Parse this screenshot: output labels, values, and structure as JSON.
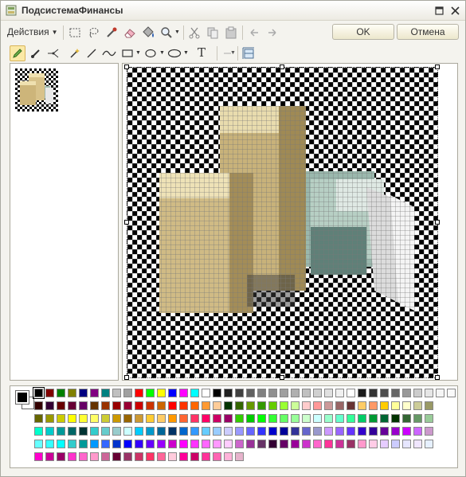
{
  "window": {
    "title": "ПодсистемаФинансы",
    "icons": [
      "app-icon",
      "maximize-icon",
      "close-icon"
    ]
  },
  "toolbar": {
    "actions_label": "Действия",
    "ok_label": "OK",
    "cancel_label": "Отмена",
    "tools_row1": [
      "select-rect-icon",
      "lasso-icon",
      "eyedropper-icon",
      "eraser-icon",
      "fill-icon",
      "zoom-icon",
      "cut-icon",
      "copy-icon",
      "paste-icon",
      "undo-icon",
      "redo-icon"
    ],
    "tools_row2": [
      "pencil-icon",
      "brush-icon",
      "line-split-icon",
      "magic-wand-icon",
      "line-icon",
      "curve-icon",
      "rectangle-icon",
      "ellipse-icon",
      "rounded-ellipse-icon",
      "text-icon",
      "line-width-icon",
      "resize-canvas-icon"
    ],
    "text_tool_glyph": "T"
  },
  "colors": {
    "accent": "#fbe9a6",
    "foreground": "#000000",
    "background": "#ffffff"
  },
  "palette": {
    "row0": [
      "#000000",
      "#800000",
      "#008000",
      "#808000",
      "#000080",
      "#800080",
      "#008080",
      "#c0c0c0",
      "#a0a0a0",
      "#ff0000",
      "#00ff00",
      "#ffff00",
      "#0000ff",
      "#ff00ff",
      "#00ffff",
      "#ffffff",
      "#000000",
      "#202020",
      "#404040",
      "#606060",
      "#808080",
      "#909090",
      "#a0a0a0",
      "#b0b0b0",
      "#c0c0c0",
      "#d0d0d0",
      "#e0e0e0",
      "#f0f0f0",
      "#ffffff",
      "#1a1a1a",
      "#333333",
      "#4d4d4d",
      "#666666",
      "#999999",
      "#cccccc",
      "#e6e6e6",
      "#f5f5f5",
      "#fafafa"
    ],
    "row1": [
      "#330000",
      "#330033",
      "#660000",
      "#660033",
      "#660066",
      "#663300",
      "#993300",
      "#990000",
      "#990033",
      "#cc0000",
      "#cc3300",
      "#cc6600",
      "#ff0000",
      "#ff3300",
      "#ff6600",
      "#ff9933",
      "#ffcc99",
      "#003300",
      "#336600",
      "#669900",
      "#339900",
      "#66cc00",
      "#99ff33",
      "#ccff99",
      "#ffcccc",
      "#ff9999",
      "#cc9999",
      "#996666",
      "#663333",
      "#ffcc66",
      "#ff9966",
      "#ffcc00",
      "#ffff99",
      "#ffffcc",
      "#cccc99",
      "#999966"
    ],
    "row2": [
      "#666600",
      "#999900",
      "#cccc00",
      "#ffff00",
      "#ffff33",
      "#ffff66",
      "#cccc33",
      "#cc9900",
      "#996600",
      "#cc9933",
      "#ffcc33",
      "#ffcc66",
      "#ff9900",
      "#ff6633",
      "#ff3366",
      "#ff0066",
      "#cc0066",
      "#990066",
      "#33cc00",
      "#00cc00",
      "#00ff00",
      "#33ff33",
      "#66ff66",
      "#99ff99",
      "#ccffcc",
      "#ccffff",
      "#99ffcc",
      "#66ffcc",
      "#33ff99",
      "#00cc66",
      "#009933",
      "#006633",
      "#003300",
      "#336633",
      "#669966",
      "#99cc99"
    ],
    "row3": [
      "#00ffcc",
      "#00cccc",
      "#009999",
      "#006666",
      "#003333",
      "#33cccc",
      "#66cccc",
      "#99cccc",
      "#ccffff",
      "#00ccff",
      "#0099cc",
      "#006699",
      "#003366",
      "#0066cc",
      "#3399ff",
      "#66ccff",
      "#99ccff",
      "#ccccff",
      "#9999ff",
      "#6666ff",
      "#3333ff",
      "#0000cc",
      "#000099",
      "#333399",
      "#6666cc",
      "#9999cc",
      "#cc99ff",
      "#9966ff",
      "#6633ff",
      "#3300cc",
      "#330099",
      "#660099",
      "#9900cc",
      "#cc00ff",
      "#cc66ff",
      "#cc99cc"
    ],
    "row4": [
      "#66ffff",
      "#33ffff",
      "#00ffff",
      "#33cccc",
      "#009999",
      "#0099ff",
      "#3366ff",
      "#0033cc",
      "#0000ff",
      "#3300ff",
      "#6600ff",
      "#9900ff",
      "#cc00cc",
      "#ff00ff",
      "#ff33ff",
      "#ff66ff",
      "#ff99ff",
      "#ffccff",
      "#cc66cc",
      "#993399",
      "#663366",
      "#330033",
      "#660066",
      "#990099",
      "#cc33cc",
      "#ff66cc",
      "#ff3399",
      "#cc3399",
      "#993366",
      "#ff99cc",
      "#ffcce6",
      "#e6ccff",
      "#ccccff",
      "#e6e6ff",
      "#f0e6ff",
      "#e6f0ff"
    ],
    "row5": [
      "#ff00cc",
      "#cc0099",
      "#990066",
      "#ff33cc",
      "#ff66cc",
      "#ff99cc",
      "#cc6699",
      "#660033",
      "#993366",
      "#cc3366",
      "#ff3366",
      "#ff6699",
      "#ffccdd",
      "#ff0099",
      "#cc0066",
      "#ff3399",
      "#ff66b3",
      "#ffb3d9",
      "#e6b3cc"
    ]
  }
}
